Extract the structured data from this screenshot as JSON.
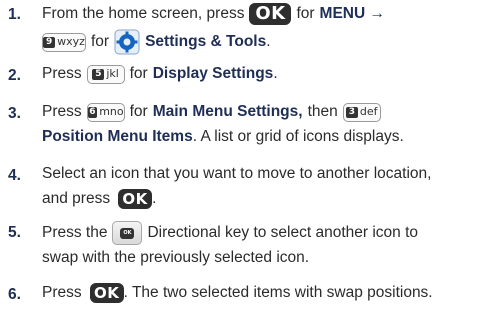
{
  "steps": [
    {
      "number": "1.",
      "line1": {
        "a": "From the home screen, press",
        "b": "for",
        "c": "MENU →"
      },
      "line2": {
        "a": "for",
        "b": "Settings & Tools",
        "c": "."
      }
    },
    {
      "number": "2.",
      "a": "Press",
      "b": "for",
      "c": "Display Settings",
      "d": "."
    },
    {
      "number": "3.",
      "line1": {
        "a": "Press",
        "b": "for",
        "c": "Main Menu Settings,",
        "d": "then"
      },
      "line2": {
        "a": "Position Menu Items",
        "b": ". A list or grid of icons displays."
      }
    },
    {
      "number": "4.",
      "line1": "Select an icon that you want to move to another location,",
      "line2": "and press",
      "end": "."
    },
    {
      "number": "5.",
      "line1": {
        "a": "Press the",
        "b": "Directional key to select another icon to"
      },
      "line2": "swap with the previously selected icon."
    },
    {
      "number": "6.",
      "a": "Press",
      "b": ". The two selected items with swap positions."
    }
  ],
  "keys": {
    "ok": "OK",
    "key9_num": "9",
    "key9_letters": "wxyz",
    "key5_num": "5",
    "key5_letters": "jkl",
    "key6_num": "6",
    "key6_letters": "mno",
    "key3_num": "3",
    "key3_letters": "def",
    "dpad_center": "OK"
  },
  "icons": [
    "ok-key-icon",
    "key-9-icon",
    "settings-gear-icon",
    "key-5-icon",
    "key-6-icon",
    "key-3-icon",
    "directional-key-icon"
  ],
  "colors": {
    "bold_text": "#1e2e55",
    "key_dark": "#2e2e2e",
    "gear_blue": "#1565c0"
  }
}
